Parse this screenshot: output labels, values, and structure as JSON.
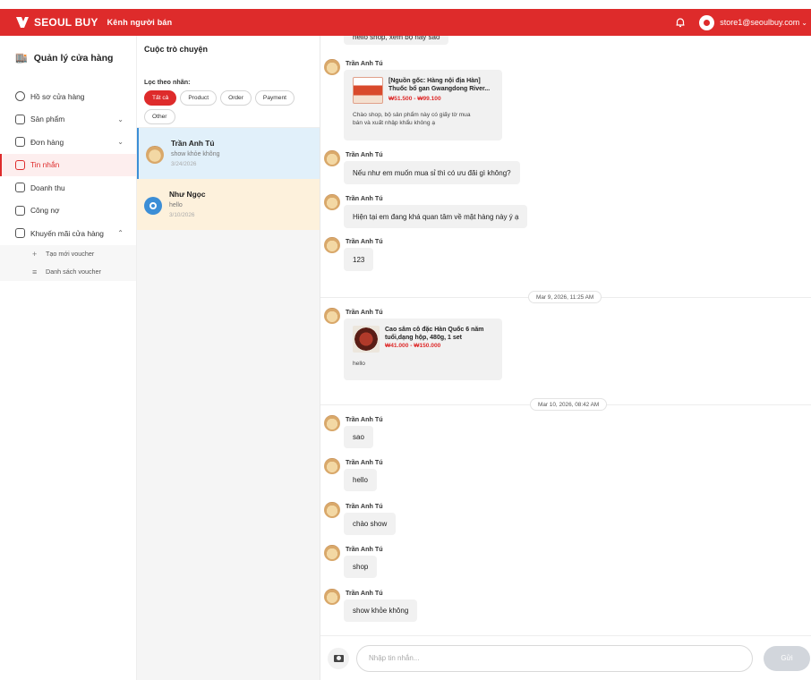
{
  "topbar": {
    "brand": "SEOUL BUY",
    "subtitle": "Kênh người bán",
    "user_email": "store1@seoulbuy.com",
    "accent": "#de2b2b"
  },
  "sidebar": {
    "title": "Quản lý cửa hàng",
    "items": [
      {
        "label": "Hồ sơ cửa hàng",
        "icon": "store-profile-icon"
      },
      {
        "label": "Sản phẩm",
        "icon": "box-icon"
      },
      {
        "label": "Đơn hàng",
        "icon": "cart-icon"
      },
      {
        "label": "Tin nhắn",
        "icon": "chat-icon"
      },
      {
        "label": "Doanh thu",
        "icon": "revenue-icon"
      },
      {
        "label": "Công nợ",
        "icon": "debt-icon"
      },
      {
        "label": "Khuyến mãi cửa hàng",
        "icon": "promo-icon"
      }
    ],
    "sub_items": [
      {
        "label": "Tạo mới voucher",
        "icon": "plus-icon"
      },
      {
        "label": "Danh sách voucher",
        "icon": "list-icon"
      }
    ]
  },
  "conversations": {
    "title": "Cuộc trò chuyện",
    "filter_label": "Lọc theo nhãn:",
    "filters": [
      "Tất cả",
      "Product",
      "Order",
      "Payment",
      "Other"
    ],
    "items": [
      {
        "name": "Trần Anh Tú",
        "last_message": "show khỏe không",
        "date": "3/24/2026"
      },
      {
        "name": "Như Ngọc",
        "last_message": "hello",
        "date": "3/10/2026"
      }
    ]
  },
  "chat": {
    "clipped_top_text": "hello shop, xem bộ này sao",
    "sender": "Trần Anh Tú",
    "product_1": {
      "title_line1": "[Nguồn gốc: Hàng nội địa Hàn]",
      "title_line2": "Thuốc bổ gan Gwangdong River...",
      "price": "₩51.500 - ₩99.100",
      "message_line1": "Chào shop, bộ sản phẩm này có giấy tờ mua",
      "message_line2": "bán và xuất nhập khẩu không ạ"
    },
    "messages_a": [
      "Nếu như em muốn mua sỉ thì có ưu đãi gì không?",
      "Hiện tại em đang khá quan tâm về mặt hàng này ý ạ",
      "123"
    ],
    "separator_1": "Mar 9, 2026, 11:25 AM",
    "product_2": {
      "title_line1": "Cao sâm cô đặc Hàn Quốc 6 năm",
      "title_line2": "tuổi,dạng hộp, 480g, 1 set",
      "price": "₩41.000 - ₩150.000",
      "message": "hello"
    },
    "separator_2": "Mar 10, 2026, 08:42 AM",
    "messages_b": [
      "sao",
      "hello",
      "chào show",
      "shop",
      "show khỏe không"
    ]
  },
  "composer": {
    "placeholder": "Nhập tin nhắn...",
    "send_label": "Gửi"
  }
}
